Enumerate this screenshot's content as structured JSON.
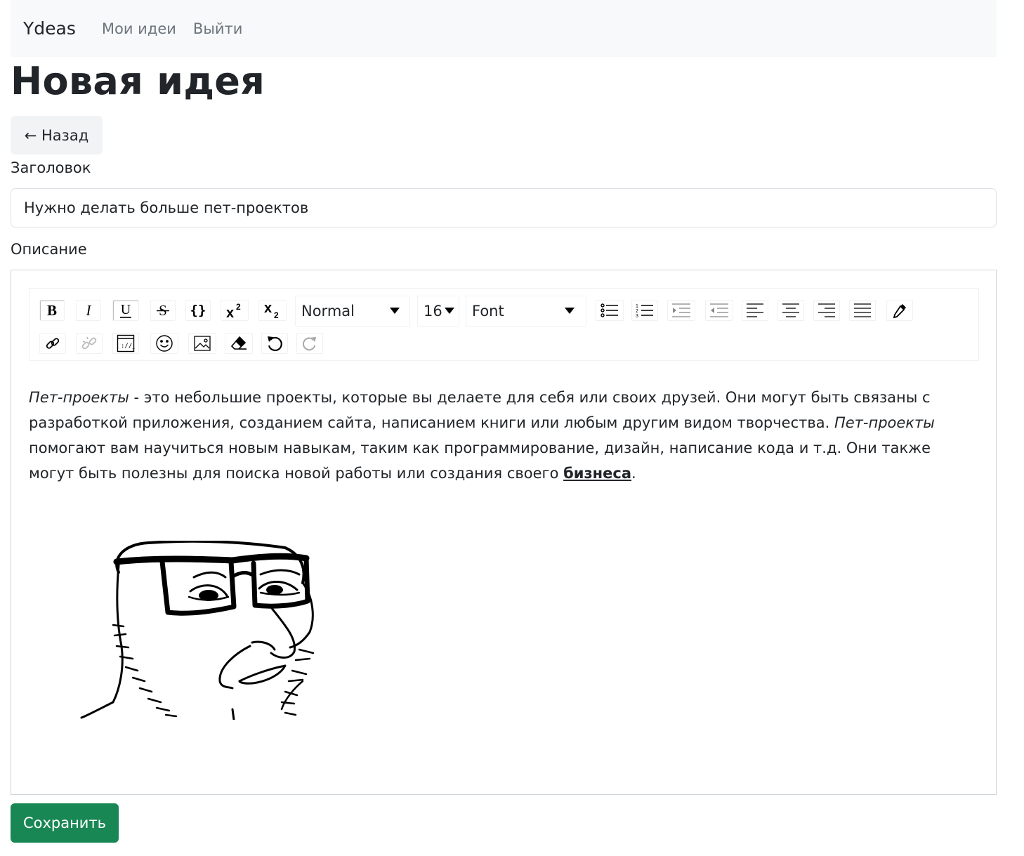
{
  "navbar": {
    "brand": "Ydeas",
    "links": [
      "Мои идеи",
      "Выйти"
    ]
  },
  "page": {
    "title": "Новая идея",
    "back_label": "← Назад"
  },
  "form": {
    "title_label": "Заголовок",
    "title_value": "Нужно делать больше пет-проектов",
    "description_label": "Описание",
    "save_label": "Сохранить"
  },
  "toolbar": {
    "block_type": "Normal",
    "font_size": "16",
    "font_family": "Font",
    "buttons_row1": [
      "bold-icon",
      "italic-icon",
      "underline-icon",
      "strikethrough-icon",
      "code-icon",
      "superscript-icon",
      "subscript-icon"
    ],
    "buttons_row1_after": [
      "unordered-list-icon",
      "ordered-list-icon",
      "indent-icon",
      "outdent-icon",
      "align-left-icon",
      "align-center-icon",
      "align-right-icon",
      "align-justify-icon",
      "color-picker-icon"
    ],
    "buttons_row2": [
      "link-icon",
      "unlink-icon",
      "embedded-icon",
      "emoji-icon",
      "image-icon",
      "eraser-icon",
      "undo-icon",
      "redo-icon"
    ]
  },
  "description": {
    "p1": "Пет-проекты",
    "p2": " - это небольшие проекты, которые вы делаете для себя или своих друзей. Они могут быть связаны с разработкой приложения, созданием сайта, написанием книги или любым другим видом творчества. ",
    "p3": "Пет-проекты",
    "p4": " помогают вам научиться новым навыкам, таким как программирование, дизайн, написание кода и т.д. Они также могут быть полезны для поиска новой работы или создания своего ",
    "p5": "бизнеса",
    "p6": "."
  },
  "colors": {
    "navbar_bg": "#f8f9fa",
    "save_button": "#198754",
    "nav_link": "#6c757d"
  }
}
